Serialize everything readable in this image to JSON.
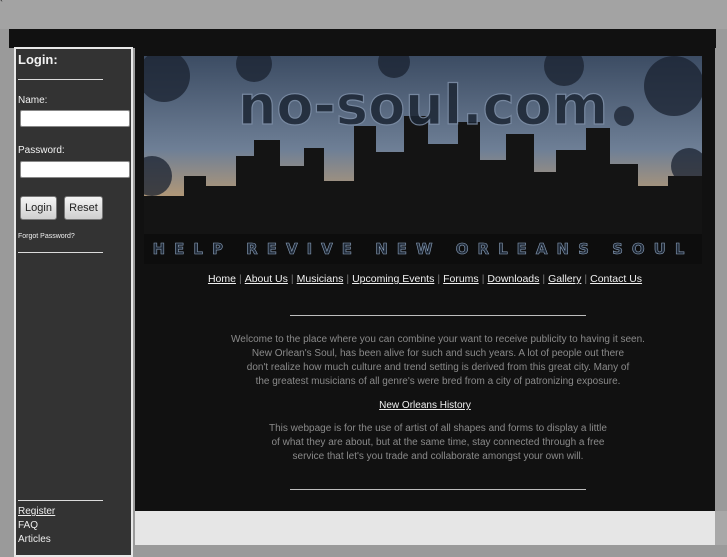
{
  "login": {
    "title": "Login:",
    "name_label": "Name:",
    "password_label": "Password:",
    "name_value": "",
    "password_value": "",
    "login_button": "Login",
    "reset_button": "Reset",
    "forgot_link": "Forgot Password?"
  },
  "sidebar_links": {
    "register": "Register",
    "faq": "FAQ",
    "articles": "Articles"
  },
  "banner": {
    "logo_text": "no-soul.com",
    "tagline": "HELP REVIVE NEW ORLEANS SOUL"
  },
  "nav": {
    "items": [
      "Home",
      "About Us",
      "Musicians",
      "Upcoming Events",
      "Forums",
      "Downloads",
      "Gallery",
      "Contact Us"
    ]
  },
  "content": {
    "welcome_lines": [
      "Welcome to the place where you can combine your want to receive publicity to having it seen.",
      "New Orlean's Soul, has been alive for such and such years.  A lot of people out there",
      "don't realize how much culture and trend setting is derived from this great city.  Many of",
      "the greatest musicians of all genre's were bred from a city of patronizing exposure."
    ],
    "history_link": "New Orleans History",
    "purpose_lines": [
      "This webpage is for the use of artist of all shapes and forms to display a little",
      "of what they are about, but at the same time, stay connected through a free",
      "service that let's you trade and collaborate amongst your own will."
    ]
  },
  "colors": {
    "page_background": "#9a9a9a",
    "main_background": "#111111",
    "sidebar_background": "#333333",
    "body_text": "#8a8a8a",
    "link_text": "#f0f0f0"
  }
}
